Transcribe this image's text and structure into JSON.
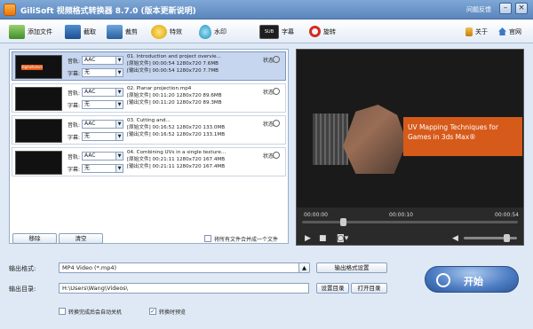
{
  "window": {
    "title": "GiliSoft 视频格式转换器 8.7.0 (版本更新说明)",
    "feedback": "问题反馈"
  },
  "toolbar": {
    "add_file": "添加文件",
    "clip": "截取",
    "crop": "裁剪",
    "effects": "特效",
    "watermark": "水印",
    "subtitle": "字幕",
    "rotate": "旋转",
    "about": "关于",
    "website": "官网"
  },
  "file_list": {
    "audio_label": "音轨:",
    "subtitle_label": "字幕:",
    "audio_value": "AAC",
    "subtitle_value": "无",
    "status_label": "状态",
    "items": [
      {
        "name": "01. Introduction and project overvie...",
        "source": "[原始文件]  00:00:54  1280x720  7.6MB",
        "output": "[输出文件]  00:00:54  1280x720  7.7MB",
        "thumb_text": "digitaltutors"
      },
      {
        "name": "02. Planar projection.mp4",
        "source": "[原始文件]  00:11:20  1280x720  89.6MB",
        "output": "[输出文件]  00:11:20  1280x720  89.3MB",
        "thumb_text": ""
      },
      {
        "name": "03. Cutting and...",
        "source": "[原始文件]  00:16:52  1280x720  133.0MB",
        "output": "[输出文件]  00:16:52  1280x720  133.1MB",
        "thumb_text": ""
      },
      {
        "name": "04. Combining UVs in a single texture...",
        "source": "[原始文件]  00:21:11  1280x720  167.4MB",
        "output": "[输出文件]  00:21:11  1280x720  167.4MB",
        "thumb_text": ""
      }
    ],
    "remove_button": "移除",
    "clear_button": "清空",
    "merge_label": "将所有文件合并成一个文件"
  },
  "preview": {
    "video_title": "UV Mapping Techniques for Games in 3ds Max®",
    "time_start": "00:00:00",
    "time_current": "00:00:10",
    "time_end": "00:00:54",
    "progress_fraction": 0.19,
    "volume_fraction": 0.8
  },
  "output": {
    "format_label": "输出格式:",
    "format_value": "MP4 Video (*.mp4)",
    "format_settings_button": "输出格式设置",
    "dir_label": "输出目录:",
    "dir_value": "H:\\Users\\Wang\\Videos\\",
    "set_dir_button": "设置目录",
    "open_dir_button": "打开目录",
    "shutdown_label": "转换完成后会自动关机",
    "preview_label": "转换时预览"
  },
  "start_button": "开始",
  "colors": {
    "accent": "#4c7cc2",
    "titlebar": "#6a95c8",
    "selected_row": "#c7d6ef",
    "banner_orange": "#d65a1a"
  }
}
